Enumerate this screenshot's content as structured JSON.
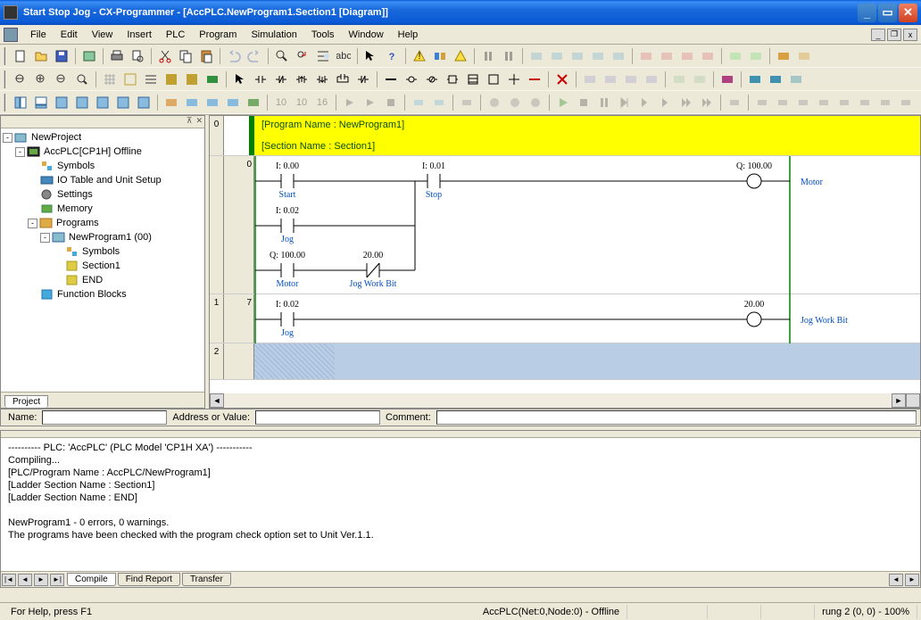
{
  "title": "Start Stop Jog - CX-Programmer - [AccPLC.NewProgram1.Section1 [Diagram]]",
  "menu": [
    "File",
    "Edit",
    "View",
    "Insert",
    "PLC",
    "Program",
    "Simulation",
    "Tools",
    "Window",
    "Help"
  ],
  "tree": {
    "root": "NewProject",
    "plc": "AccPLC[CP1H] Offline",
    "items": [
      "Symbols",
      "IO Table and Unit Setup",
      "Settings",
      "Memory"
    ],
    "programs_label": "Programs",
    "program": "NewProgram1 (00)",
    "program_children": [
      "Symbols",
      "Section1",
      "END"
    ],
    "fb": "Function Blocks",
    "tab": "Project"
  },
  "ladder": {
    "prog_header": "[Program Name : NewProgram1]",
    "sec_header": "[Section Name : Section1]",
    "r0": {
      "start_a": "I: 0.00",
      "start_n": "Start",
      "stop_a": "I: 0.01",
      "stop_n": "Stop",
      "jog_a": "I: 0.02",
      "jog_n": "Jog",
      "motor_a": "Q: 100.00",
      "motor_n": "Motor",
      "jwb_a": "20.00",
      "jwb_n": "Jog Work Bit",
      "out_a": "Q: 100.00",
      "out_n": "Motor"
    },
    "r1": {
      "jog_a": "I: 0.02",
      "jog_n": "Jog",
      "out_a": "20.00",
      "out_n": "Jog Work Bit"
    }
  },
  "nav": {
    "name_label": "Name:",
    "addr_label": "Address or Value:",
    "comment_label": "Comment:"
  },
  "output": {
    "l1": "---------- PLC: 'AccPLC' (PLC Model 'CP1H XA') -----------",
    "l2": "Compiling...",
    "l3": "[PLC/Program Name : AccPLC/NewProgram1]",
    "l4": "[Ladder Section Name : Section1]",
    "l5": "[Ladder Section Name : END]",
    "l6": "NewProgram1 - 0 errors, 0 warnings.",
    "l7": "The programs have been checked with the program check option set to Unit Ver.1.1.",
    "tabs": [
      "Compile",
      "Find Report",
      "Transfer"
    ]
  },
  "status": {
    "help": "For Help, press F1",
    "plc": "AccPLC(Net:0,Node:0) - Offline",
    "rung": "rung 2 (0, 0)  - 100%"
  }
}
